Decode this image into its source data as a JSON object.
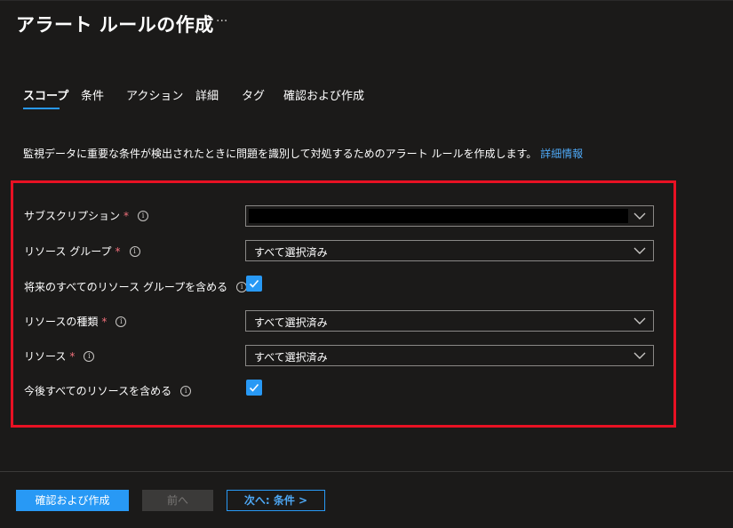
{
  "header": {
    "title": "アラート ルールの作成",
    "more": "···"
  },
  "tabs": [
    {
      "label": "スコープ",
      "active": true
    },
    {
      "label": "条件"
    },
    {
      "label": "アクション"
    },
    {
      "label": "詳細"
    },
    {
      "label": "タグ"
    },
    {
      "label": "確認および作成"
    }
  ],
  "description": {
    "text": "監視データに重要な条件が検出されたときに問題を識別して対処するためのアラート ルールを作成します。",
    "link": "詳細情報"
  },
  "form": {
    "subscription": {
      "label": "サブスクリプション",
      "required": "*",
      "value": ""
    },
    "resource_group": {
      "label": "リソース グループ",
      "required": "*",
      "value": "すべて選択済み"
    },
    "include_future_rg": {
      "label": "将来のすべてのリソース グループを含める",
      "checked": true
    },
    "resource_type": {
      "label": "リソースの種類",
      "required": "*",
      "value": "すべて選択済み"
    },
    "resource": {
      "label": "リソース",
      "required": "*",
      "value": "すべて選択済み"
    },
    "include_future_resources": {
      "label": "今後すべてのリソースを含める",
      "checked": true
    }
  },
  "footer": {
    "review_create": "確認および作成",
    "previous": "前へ",
    "next": "次へ: 条件 >"
  },
  "colors": {
    "accent": "#2899f5",
    "background": "#1b1a19",
    "highlight_box": "#e81123",
    "required": "#f1707b"
  }
}
